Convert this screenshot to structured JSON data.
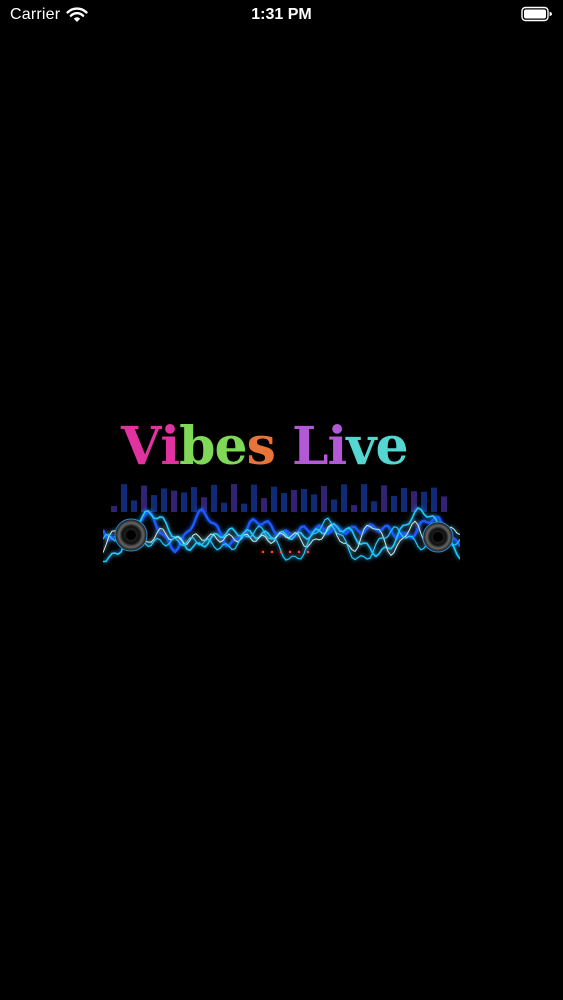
{
  "status_bar": {
    "carrier": "Carrier",
    "time": "1:31 PM"
  },
  "logo": {
    "title": "Vibes Live",
    "letters": [
      {
        "char": "V",
        "color": "#e0339f"
      },
      {
        "char": "i",
        "color": "#e0339f"
      },
      {
        "char": "b",
        "color": "#7fd957"
      },
      {
        "char": "e",
        "color": "#7fd957"
      },
      {
        "char": "s",
        "color": "#e8743a"
      },
      {
        "char": " ",
        "color": "#000000"
      },
      {
        "char": "L",
        "color": "#b25ad6"
      },
      {
        "char": "i",
        "color": "#b25ad6"
      },
      {
        "char": "v",
        "color": "#55d6d0"
      },
      {
        "char": "e",
        "color": "#55d6d0"
      }
    ],
    "wave_colors": [
      "#1a5cff",
      "#22c7ff",
      "#b8f3ff"
    ]
  }
}
